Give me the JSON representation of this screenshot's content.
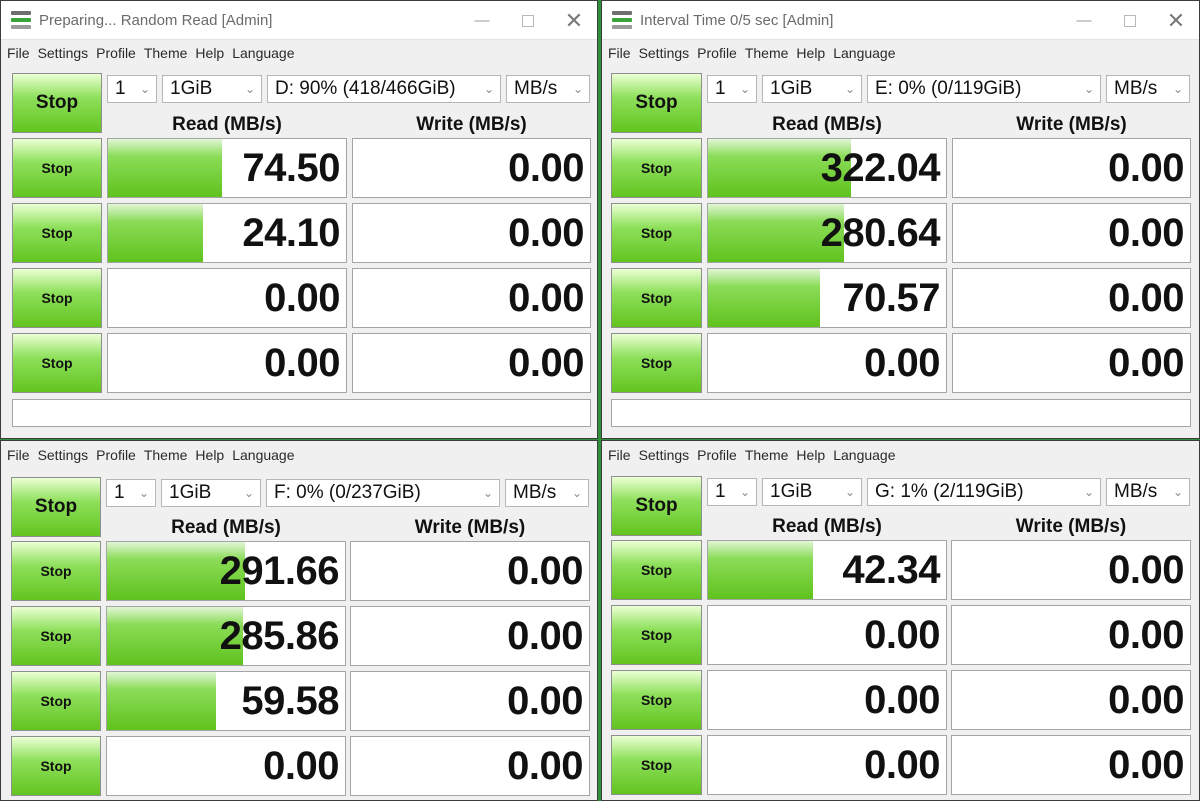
{
  "windows": [
    {
      "id": "w1",
      "title": "Preparing... Random Read [Admin]",
      "menu": [
        "File",
        "Settings",
        "Profile",
        "Theme",
        "Help",
        "Language"
      ],
      "count": "1",
      "size": "1GiB",
      "drive": "D: 90% (418/466GiB)",
      "unit": "MB/s",
      "main_button": "Stop",
      "read_header": "Read (MB/s)",
      "write_header": "Write (MB/s)",
      "rows": [
        {
          "button": "Stop",
          "read": "74.50",
          "read_fill": 0.48,
          "write": "0.00",
          "write_fill": 0
        },
        {
          "button": "Stop",
          "read": "24.10",
          "read_fill": 0.4,
          "write": "0.00",
          "write_fill": 0
        },
        {
          "button": "Stop",
          "read": "0.00",
          "read_fill": 0,
          "write": "0.00",
          "write_fill": 0
        },
        {
          "button": "Stop",
          "read": "0.00",
          "read_fill": 0,
          "write": "0.00",
          "write_fill": 0
        }
      ]
    },
    {
      "id": "w2",
      "title": "Interval Time 0/5 sec [Admin]",
      "menu": [
        "File",
        "Settings",
        "Profile",
        "Theme",
        "Help",
        "Language"
      ],
      "count": "1",
      "size": "1GiB",
      "drive": "E: 0% (0/119GiB)",
      "unit": "MB/s",
      "main_button": "Stop",
      "read_header": "Read (MB/s)",
      "write_header": "Write (MB/s)",
      "rows": [
        {
          "button": "Stop",
          "read": "322.04",
          "read_fill": 0.6,
          "write": "0.00",
          "write_fill": 0
        },
        {
          "button": "Stop",
          "read": "280.64",
          "read_fill": 0.57,
          "write": "0.00",
          "write_fill": 0
        },
        {
          "button": "Stop",
          "read": "70.57",
          "read_fill": 0.47,
          "write": "0.00",
          "write_fill": 0
        },
        {
          "button": "Stop",
          "read": "0.00",
          "read_fill": 0,
          "write": "0.00",
          "write_fill": 0
        }
      ]
    },
    {
      "id": "w3",
      "menu": [
        "File",
        "Settings",
        "Profile",
        "Theme",
        "Help",
        "Language"
      ],
      "count": "1",
      "size": "1GiB",
      "drive": "F: 0% (0/237GiB)",
      "unit": "MB/s",
      "main_button": "Stop",
      "read_header": "Read (MB/s)",
      "write_header": "Write (MB/s)",
      "rows": [
        {
          "button": "Stop",
          "read": "291.66",
          "read_fill": 0.58,
          "write": "0.00",
          "write_fill": 0
        },
        {
          "button": "Stop",
          "read": "285.86",
          "read_fill": 0.57,
          "write": "0.00",
          "write_fill": 0
        },
        {
          "button": "Stop",
          "read": "59.58",
          "read_fill": 0.46,
          "write": "0.00",
          "write_fill": 0
        },
        {
          "button": "Stop",
          "read": "0.00",
          "read_fill": 0,
          "write": "0.00",
          "write_fill": 0
        }
      ]
    },
    {
      "id": "w4",
      "menu": [
        "File",
        "Settings",
        "Profile",
        "Theme",
        "Help",
        "Language"
      ],
      "count": "1",
      "size": "1GiB",
      "drive": "G: 1% (2/119GiB)",
      "unit": "MB/s",
      "main_button": "Stop",
      "read_header": "Read (MB/s)",
      "write_header": "Write (MB/s)",
      "rows": [
        {
          "button": "Stop",
          "read": "42.34",
          "read_fill": 0.44,
          "write": "0.00",
          "write_fill": 0
        },
        {
          "button": "Stop",
          "read": "0.00",
          "read_fill": 0,
          "write": "0.00",
          "write_fill": 0
        },
        {
          "button": "Stop",
          "read": "0.00",
          "read_fill": 0,
          "write": "0.00",
          "write_fill": 0
        },
        {
          "button": "Stop",
          "read": "0.00",
          "read_fill": 0,
          "write": "0.00",
          "write_fill": 0
        }
      ]
    }
  ]
}
